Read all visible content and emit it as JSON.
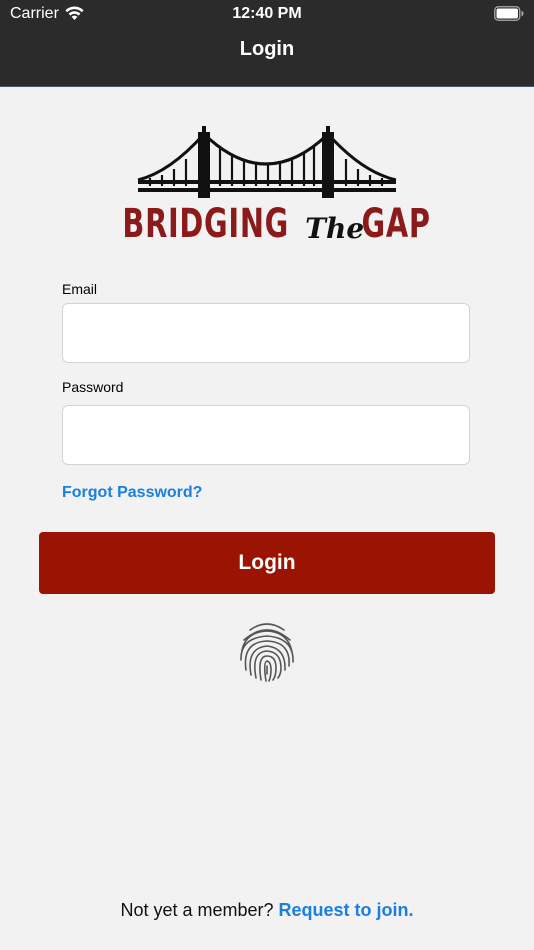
{
  "status_bar": {
    "carrier": "Carrier",
    "time": "12:40 PM",
    "wifi_icon": "wifi-icon",
    "battery_icon": "battery-icon"
  },
  "nav": {
    "title": "Login"
  },
  "logo": {
    "word_left": "BRIDGING",
    "word_mid": "The",
    "word_right": "GAP",
    "brand_color": "#8b1a1a"
  },
  "form": {
    "email_label": "Email",
    "email_value": "",
    "password_label": "Password",
    "password_value": "",
    "forgot_label": "Forgot Password?",
    "login_label": "Login",
    "biometric_icon": "fingerprint-icon"
  },
  "footer": {
    "prompt": "Not yet a member?",
    "join_label": "Request to join."
  },
  "colors": {
    "header_bg": "#2b2b2b",
    "page_bg": "#f2f2f2",
    "primary_button": "#9b1303",
    "link": "#1a7fe0"
  }
}
